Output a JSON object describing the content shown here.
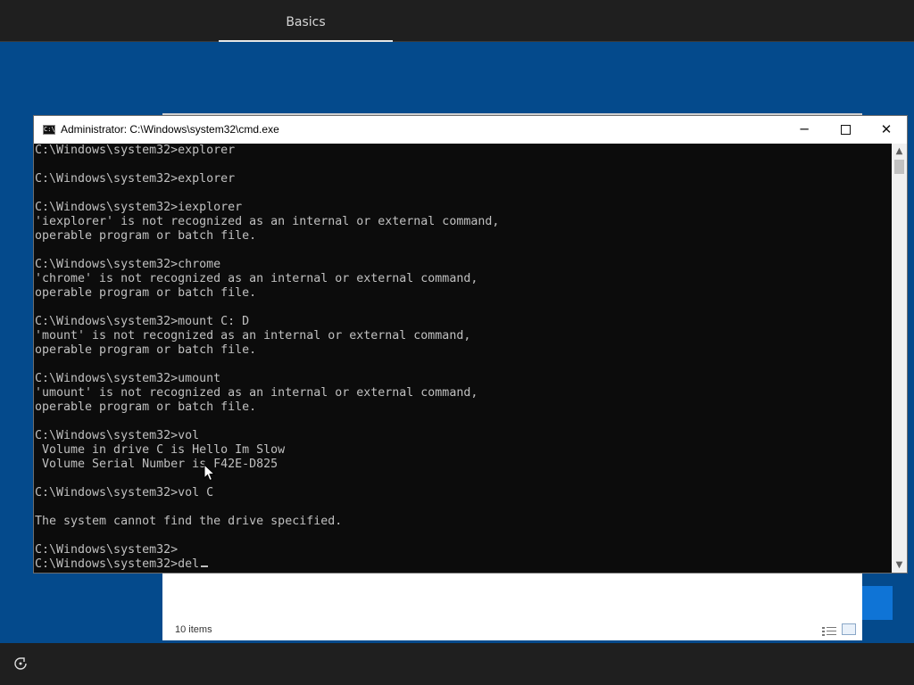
{
  "topbar": {
    "tab_label": "Basics"
  },
  "cmd": {
    "title": "Administrator: C:\\Windows\\system32\\cmd.exe",
    "icon_text": "C:\\",
    "lines": [
      "C:\\Windows\\system32>explorer",
      "",
      "C:\\Windows\\system32>explorer",
      "",
      "C:\\Windows\\system32>iexplorer",
      "'iexplorer' is not recognized as an internal or external command,",
      "operable program or batch file.",
      "",
      "C:\\Windows\\system32>chrome",
      "'chrome' is not recognized as an internal or external command,",
      "operable program or batch file.",
      "",
      "C:\\Windows\\system32>mount C: D",
      "'mount' is not recognized as an internal or external command,",
      "operable program or batch file.",
      "",
      "C:\\Windows\\system32>umount",
      "'umount' is not recognized as an internal or external command,",
      "operable program or batch file.",
      "",
      "C:\\Windows\\system32>vol",
      " Volume in drive C is Hello Im Slow",
      " Volume Serial Number is F42E-D825",
      "",
      "C:\\Windows\\system32>vol C",
      "",
      "The system cannot find the drive specified.",
      "",
      "C:\\Windows\\system32>"
    ],
    "current_input": "C:\\Windows\\system32>del"
  },
  "explorer": {
    "status": "10 items"
  },
  "icons": {
    "minimize": "minimize-icon",
    "maximize": "maximize-icon",
    "close": "close-icon",
    "ease_of_access": "ease-of-access-icon",
    "scroll_up": "scroll-up-icon",
    "scroll_down": "scroll-down-icon"
  },
  "colors": {
    "desktop": "#044a8c",
    "console_bg": "#0c0c0c",
    "console_text": "#c0c0c0",
    "bars": "#1f1f1f"
  }
}
